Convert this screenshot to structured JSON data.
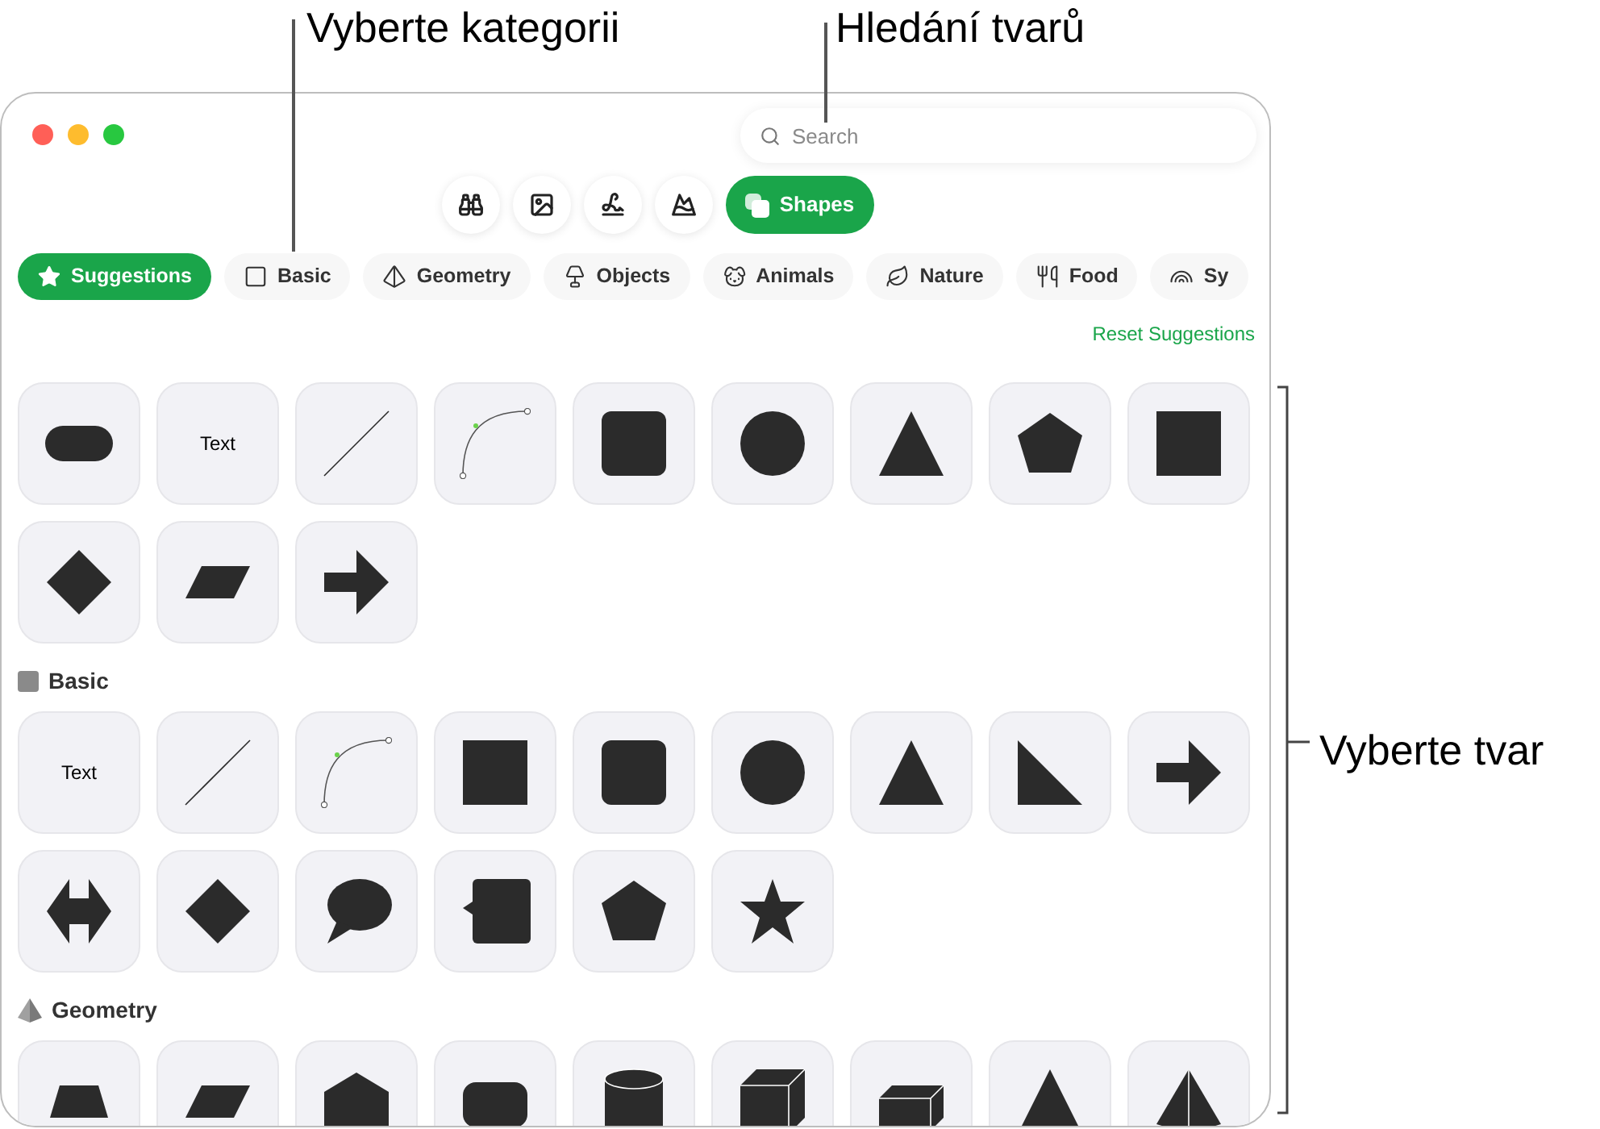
{
  "callouts": {
    "category": "Vyberte kategorii",
    "search": "Hledání tvarů",
    "shape": "Vyberte tvar"
  },
  "window": {
    "search": {
      "placeholder": "Search"
    },
    "modes": [
      {
        "kind": "binoculars",
        "selected": false
      },
      {
        "kind": "image",
        "selected": false
      },
      {
        "kind": "scribble",
        "selected": false
      },
      {
        "kind": "mountains",
        "selected": false
      },
      {
        "kind": "shapes",
        "label": "Shapes",
        "selected": true
      }
    ],
    "categories": [
      {
        "kind": "star",
        "label": "Suggestions",
        "selected": true
      },
      {
        "kind": "square",
        "label": "Basic",
        "selected": false
      },
      {
        "kind": "pyramid",
        "label": "Geometry",
        "selected": false
      },
      {
        "kind": "lamp",
        "label": "Objects",
        "selected": false
      },
      {
        "kind": "dog",
        "label": "Animals",
        "selected": false
      },
      {
        "kind": "leaf",
        "label": "Nature",
        "selected": false
      },
      {
        "kind": "utensils",
        "label": "Food",
        "selected": false
      },
      {
        "kind": "rainbow",
        "label": "Sy",
        "selected": false
      }
    ],
    "reset_link": "Reset Suggestions",
    "sections": [
      {
        "tiles": [
          {
            "kind": "pill"
          },
          {
            "kind": "text",
            "label": "Text"
          },
          {
            "kind": "line"
          },
          {
            "kind": "curve"
          },
          {
            "kind": "rounded-square"
          },
          {
            "kind": "circle"
          },
          {
            "kind": "triangle"
          },
          {
            "kind": "pentagon"
          },
          {
            "kind": "square"
          },
          {
            "kind": "diamond"
          },
          {
            "kind": "parallelogram"
          },
          {
            "kind": "arrow"
          }
        ]
      },
      {
        "title": "Basic",
        "kind": "square",
        "tiles": [
          {
            "kind": "text",
            "label": "Text"
          },
          {
            "kind": "line"
          },
          {
            "kind": "curve"
          },
          {
            "kind": "square"
          },
          {
            "kind": "rounded-square"
          },
          {
            "kind": "circle"
          },
          {
            "kind": "triangle"
          },
          {
            "kind": "right-triangle"
          },
          {
            "kind": "arrow"
          },
          {
            "kind": "double-arrow"
          },
          {
            "kind": "diamond"
          },
          {
            "kind": "speech-bubble"
          },
          {
            "kind": "callout-square"
          },
          {
            "kind": "pentagon"
          },
          {
            "kind": "star"
          }
        ]
      },
      {
        "title": "Geometry",
        "kind": "pyramid",
        "tiles": [
          {
            "kind": "trapezoid"
          },
          {
            "kind": "parallelogram"
          },
          {
            "kind": "house"
          },
          {
            "kind": "rounded-rect"
          },
          {
            "kind": "cylinder"
          },
          {
            "kind": "cube"
          },
          {
            "kind": "box"
          },
          {
            "kind": "triangle"
          },
          {
            "kind": "pyramid"
          }
        ]
      }
    ]
  }
}
